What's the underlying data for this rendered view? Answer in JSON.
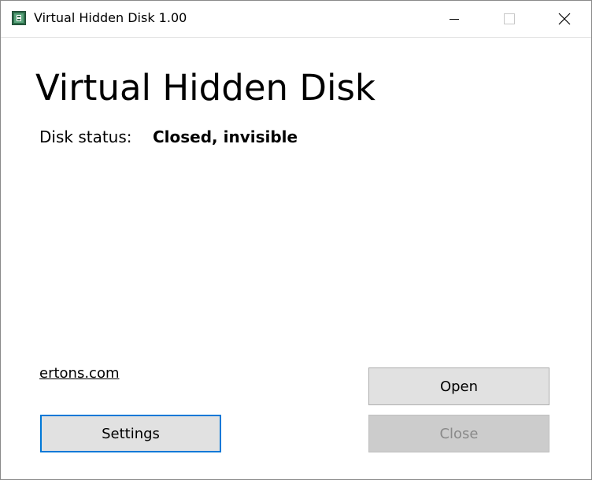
{
  "window": {
    "title": "Virtual Hidden Disk 1.00",
    "icon": "disk-app-icon",
    "controls": {
      "minimize_icon": "minimize-icon",
      "maximize_icon": "maximize-icon",
      "close_icon": "close-icon"
    }
  },
  "main": {
    "heading": "Virtual Hidden Disk",
    "status_label": "Disk status:",
    "status_value": "Closed, invisible"
  },
  "footer": {
    "link_text": "ertons.com",
    "settings_label": "Settings",
    "open_label": "Open",
    "close_label": "Close",
    "close_enabled": false
  },
  "colors": {
    "focus_border": "#0078d7",
    "button_bg": "#e1e1e1",
    "disabled_bg": "#cccccc",
    "disabled_text": "#8a8a8a"
  }
}
